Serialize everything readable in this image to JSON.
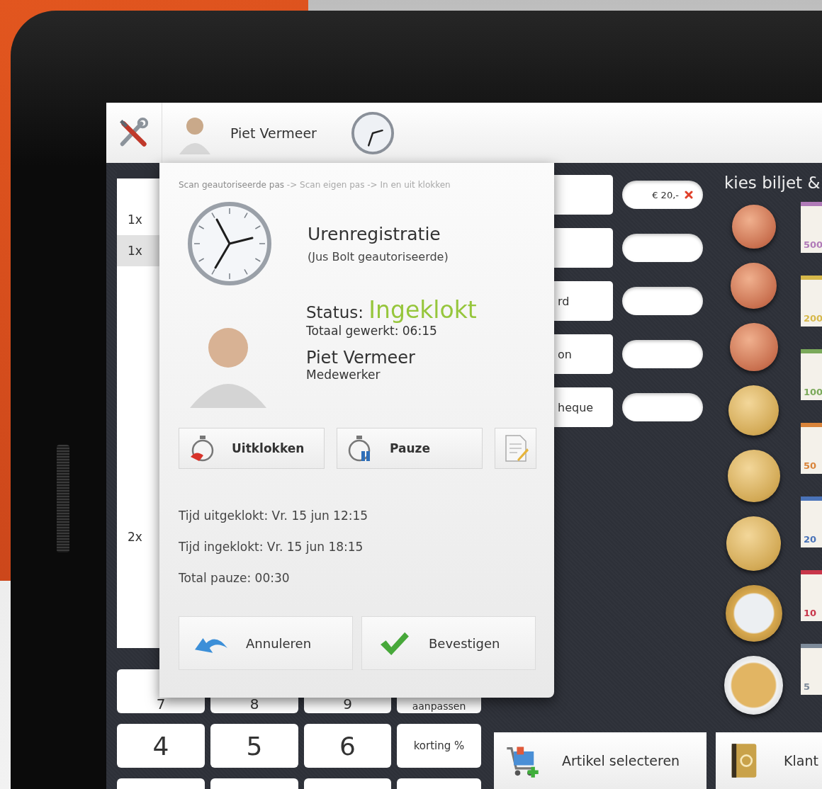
{
  "top_bar": {
    "user_name": "Piet Vermeer"
  },
  "receipt": {
    "rows": [
      {
        "qty": "1x",
        "selected": false
      },
      {
        "qty": "1x",
        "selected": true
      },
      {
        "qty": "2x",
        "selected": false
      }
    ]
  },
  "keypad": {
    "rows": [
      [
        "7",
        "8",
        "9",
        "aanpassen"
      ],
      [
        "4",
        "5",
        "6",
        "korting %"
      ]
    ]
  },
  "payment_rows": [
    {
      "amount": "€ 20,-",
      "removable": true
    },
    {
      "removable": false
    },
    {
      "label": "rd",
      "removable": false
    },
    {
      "label": "on",
      "removable": false
    },
    {
      "label": "heque",
      "removable": false
    }
  ],
  "money_panel": {
    "title": "kies biljet &",
    "coins": [
      {
        "kind": "copper"
      },
      {
        "kind": "copper"
      },
      {
        "kind": "copper"
      },
      {
        "kind": "gold"
      },
      {
        "kind": "gold"
      },
      {
        "kind": "gold"
      },
      {
        "kind": "one-euro"
      },
      {
        "kind": "two-euro"
      }
    ],
    "notes": [
      {
        "label": "500",
        "color": "#b07ab8"
      },
      {
        "label": "200",
        "color": "#d6b84a"
      },
      {
        "label": "100",
        "color": "#7aa95a"
      },
      {
        "label": "50",
        "color": "#d9843a"
      },
      {
        "label": "20",
        "color": "#4a73b8"
      },
      {
        "label": "10",
        "color": "#c8364a"
      },
      {
        "label": "5",
        "color": "#7d8a99"
      }
    ]
  },
  "bottom_buttons": [
    {
      "kind": "cart",
      "label": "Artikel selecteren"
    },
    {
      "kind": "address-book",
      "label": "Klant"
    }
  ],
  "dialog": {
    "breadcrumb": "Scan geautoriseerde pas",
    "breadcrumb_rest": "-> Scan eigen pas -> In en uit klokken",
    "title": "Urenregistratie",
    "subtitle": "(Jus Bolt geautoriseerde)",
    "status_label": "Status:",
    "status": "Ingeklokt",
    "total_worked": "Totaal gewerkt: 06:15",
    "employee_name": "Piet Vermeer",
    "role": "Medewerker",
    "actions": [
      {
        "kind": "clock-out",
        "label": "Uitklokken"
      },
      {
        "kind": "pause",
        "label": "Pauze"
      },
      {
        "kind": "note"
      }
    ],
    "info_lines": [
      "Tijd uitgeklokt: Vr. 15 jun 12:15",
      "Tijd ingeklokt: Vr. 15 jun 18:15",
      "Total pauze: 00:30"
    ],
    "buttons": [
      {
        "kind": "cancel",
        "label": "Annuleren"
      },
      {
        "kind": "confirm",
        "label": "Bevestigen"
      }
    ]
  }
}
